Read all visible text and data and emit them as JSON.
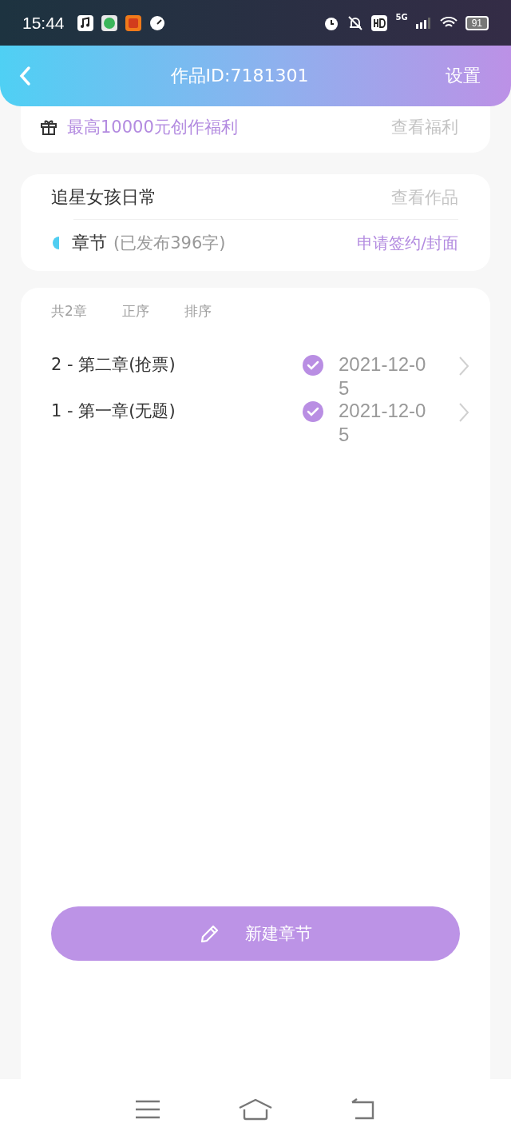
{
  "status_bar": {
    "time": "15:44",
    "network": "5G",
    "battery": "91"
  },
  "header": {
    "title": "作品ID:7181301",
    "action": "设置"
  },
  "benefit": {
    "text": "最高10000元创作福利",
    "link": "查看福利"
  },
  "work": {
    "title": "追星女孩日常",
    "link": "查看作品",
    "section": "章节",
    "published": "(已发布396字)",
    "action": "申请签约/封面"
  },
  "chapters": {
    "count": "共2章",
    "sort_order": "正序",
    "sort": "排序",
    "items": [
      {
        "title": "2 - 第二章(抢票)",
        "date": "2021-12-05"
      },
      {
        "title": "1 - 第一章(无题)",
        "date": "2021-12-05"
      }
    ]
  },
  "new_button": "新建章节"
}
